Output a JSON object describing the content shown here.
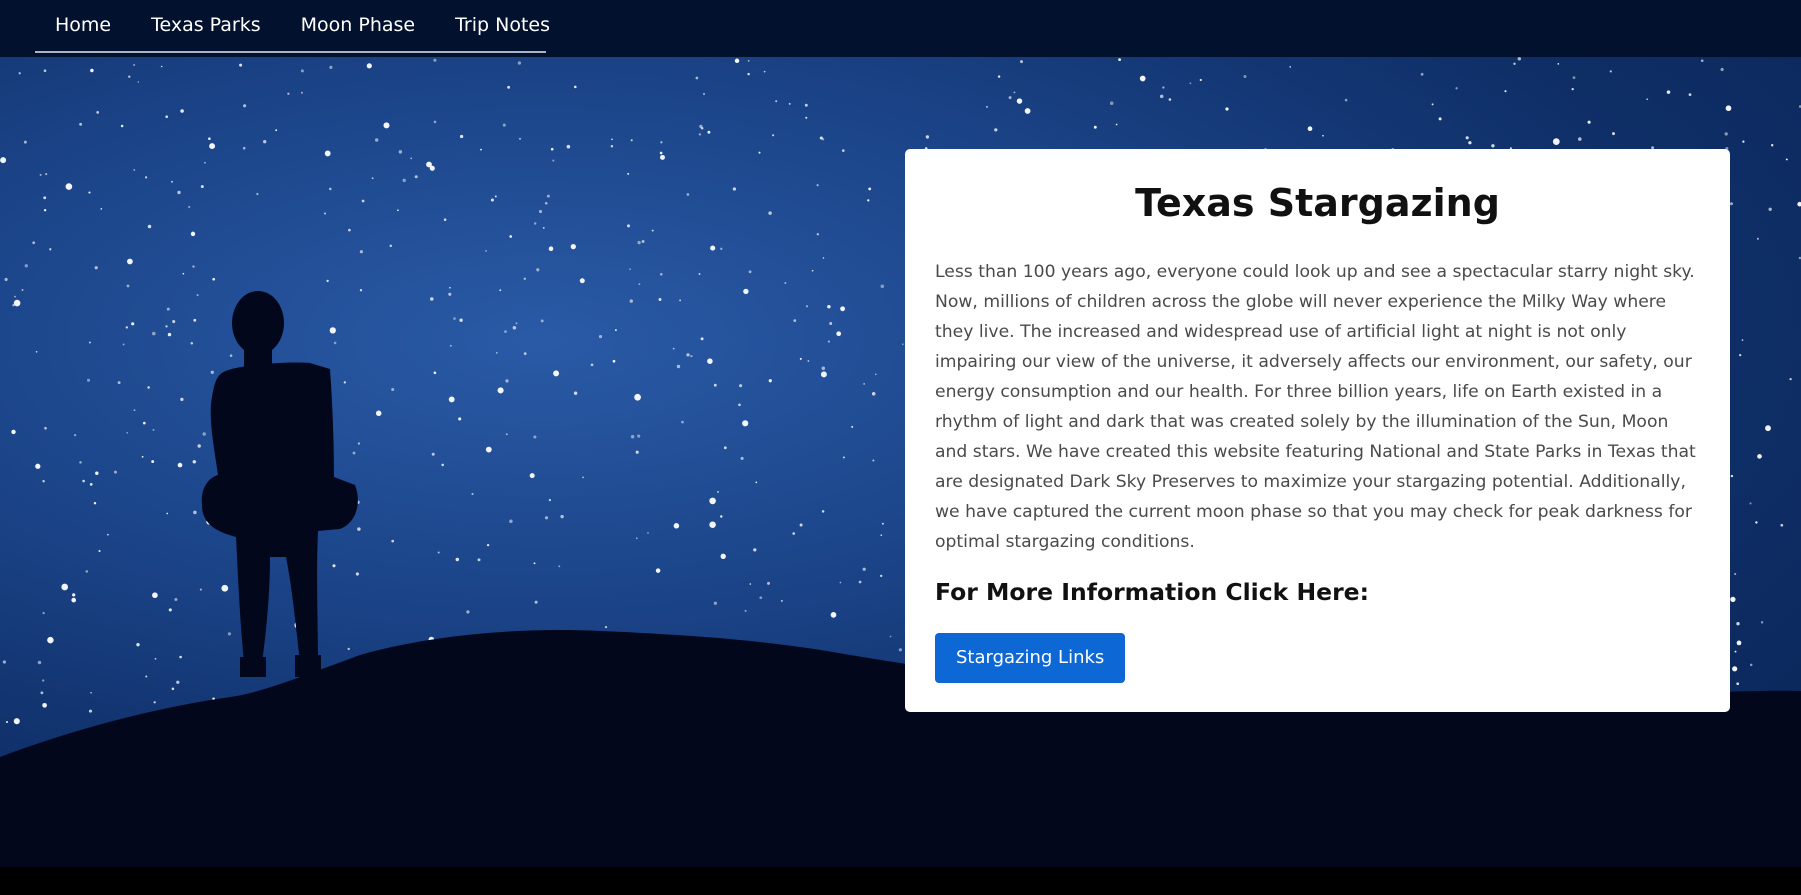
{
  "nav": {
    "items": [
      {
        "label": "Home"
      },
      {
        "label": "Texas Parks"
      },
      {
        "label": "Moon Phase"
      },
      {
        "label": "Trip Notes"
      }
    ]
  },
  "card": {
    "title": "Texas Stargazing",
    "body": "Less than 100 years ago, everyone could look up and see a spectacular starry night sky. Now, millions of children across the globe will never experience the Milky Way where they live. The increased and widespread use of artificial light at night is not only impairing our view of the universe, it adversely affects our environment, our safety, our energy consumption and our health. For three billion years, life on Earth existed in a rhythm of light and dark that was created solely by the illumination of the Sun, Moon and stars. We have created this website featuring National and State Parks in Texas that are designated Dark Sky Preserves to maximize your stargazing potential. Additionally, we have captured the current moon phase so that you may check for peak darkness for optimal stargazing conditions.",
    "subtitle": "For More Information Click Here:",
    "button_label": "Stargazing Links"
  },
  "colors": {
    "navbar_bg": "#02112e",
    "button_bg": "#0d67d4",
    "sky": "#1b4488"
  }
}
